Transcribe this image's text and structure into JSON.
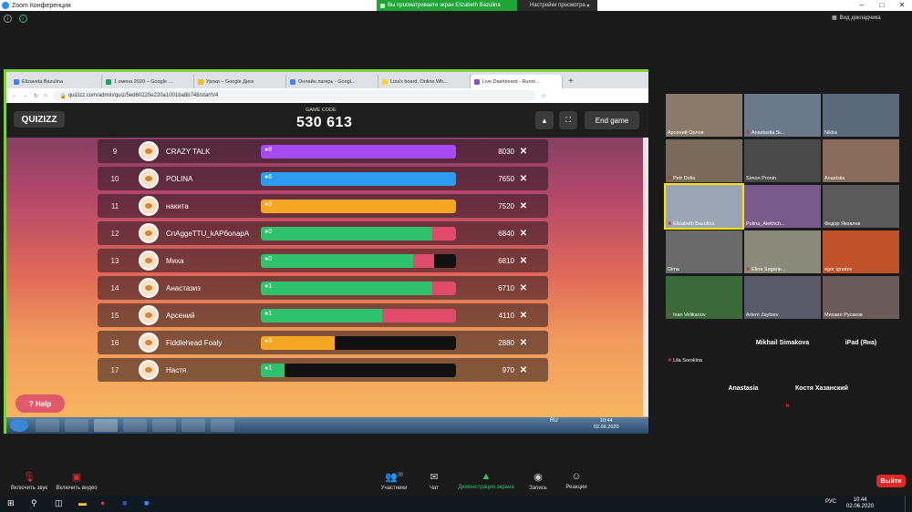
{
  "zoom": {
    "window_title": "Zoom Конференция",
    "share_banner": "Вы просматриваете экран Elizabeth Bazulina",
    "view_options": "Настройки просмотра",
    "gallery_view": "Вид докладчика"
  },
  "browser": {
    "tabs": [
      "Elizaveta Bazulina",
      "1 смена 2020 – Google ...",
      "Уроки – Google Диск",
      "Онлайн лагерь - Googl...",
      "Liza's board, Online Wh...",
      "Live Dashboard - Runni..."
    ],
    "url": "quizizz.com/admin/quiz/5ed60220e220a1001ba8b748/startV4"
  },
  "quizizz": {
    "logo": "QUIZIZZ",
    "game_code_label": "GAME CODE",
    "game_code": "530 613",
    "end_game": "End game",
    "help": "Help",
    "rows": [
      {
        "rank": "9",
        "name": "CRAZY TALK",
        "streak": "8",
        "score": "8030",
        "correct": 1.0,
        "incorrect": 0,
        "color": "#a64bf4"
      },
      {
        "rank": "10",
        "name": "POLINA",
        "streak": "6",
        "score": "7650",
        "correct": 1.0,
        "incorrect": 0,
        "color": "#2d9cf0"
      },
      {
        "rank": "11",
        "name": "накита",
        "streak": "3",
        "score": "7520",
        "correct": 1.0,
        "incorrect": 0,
        "color": "#f5a623"
      },
      {
        "rank": "12",
        "name": "СпАggeTTU_kAPбonapA",
        "streak": "0",
        "score": "6840",
        "correct": 0.88,
        "incorrect": 0.12,
        "color": "#2dc26b"
      },
      {
        "rank": "13",
        "name": "Миха",
        "streak": "0",
        "score": "6810",
        "correct": 0.78,
        "incorrect": 0.11,
        "color": "#2dc26b"
      },
      {
        "rank": "14",
        "name": "Анастазиз",
        "streak": "1",
        "score": "6710",
        "correct": 0.88,
        "incorrect": 0.12,
        "color": "#2dc26b"
      },
      {
        "rank": "15",
        "name": "Арсений",
        "streak": "1",
        "score": "4110",
        "correct": 0.62,
        "incorrect": 0.38,
        "color": "#2dc26b"
      },
      {
        "rank": "16",
        "name": "Fiddlehead Foaly",
        "streak": "3",
        "score": "2880",
        "correct": 0.38,
        "incorrect": 0,
        "color": "#f5a623"
      },
      {
        "rank": "17",
        "name": "Настя",
        "streak": "1",
        "score": "970",
        "correct": 0.12,
        "incorrect": 0,
        "color": "#2dc26b"
      }
    ]
  },
  "win7_taskbar": {
    "lang": "RU",
    "time": "10:44",
    "date": "02.06.2020"
  },
  "gallery": [
    {
      "name": "Арсений Орлов"
    },
    {
      "name": "Anastasiia Si..."
    },
    {
      "name": "Nikita"
    },
    {
      "name": "Petr Dolia"
    },
    {
      "name": "Simon Pronin"
    },
    {
      "name": "Anastsiia"
    },
    {
      "name": "Elizabeth Bazulina"
    },
    {
      "name": "Polina_Alekhch..."
    },
    {
      "name": "Федор Яковлев"
    },
    {
      "name": "Dima"
    },
    {
      "name": "Elina Sagarie..."
    },
    {
      "name": "egor ignatov"
    },
    {
      "name": "Ivan Velikanov"
    },
    {
      "name": "Artem Zaytsev"
    },
    {
      "name": "Михаил Русаков"
    },
    {
      "name": "Lila Sorokina"
    },
    {
      "name": "Mikhail Simakova"
    },
    {
      "name": "iPad (Яна)"
    },
    {
      "name": "Anastasia"
    },
    {
      "name": "Костя Хазанский"
    }
  ],
  "controls": {
    "mute": "Включить звук",
    "video": "Включить видео",
    "participants": "Участники",
    "participants_count": "20",
    "chat": "Чат",
    "share": "Демонстрация экрана",
    "record": "Запись",
    "reactions": "Реакции",
    "leave": "Выйти"
  },
  "win10_taskbar": {
    "lang": "РУС",
    "time": "10:44",
    "date": "02.06.2020"
  }
}
